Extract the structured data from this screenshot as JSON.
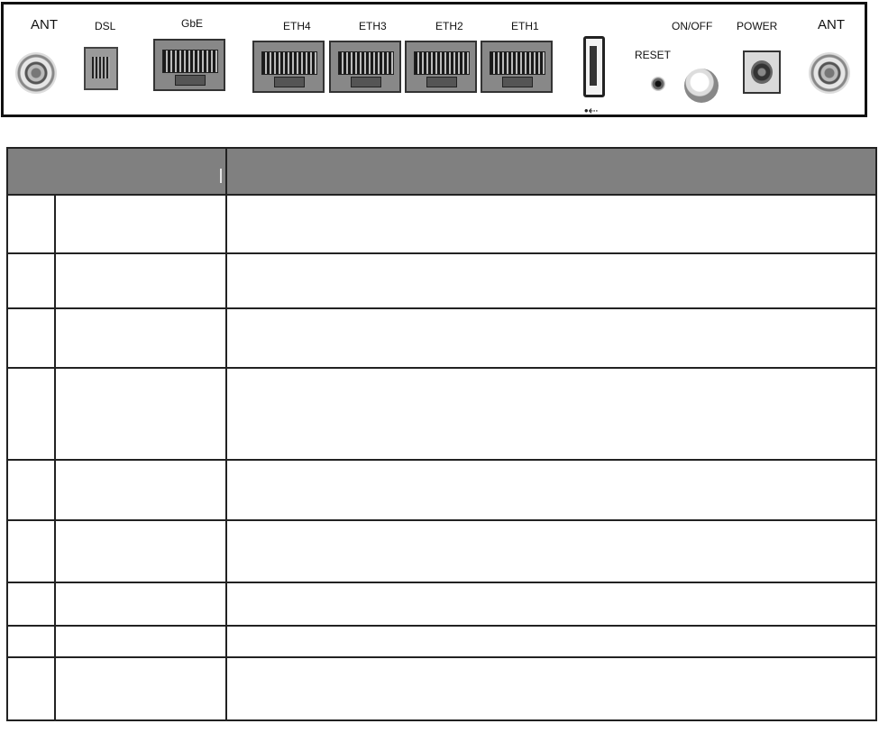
{
  "rear_panel": {
    "labels": {
      "ant_left": "ANT",
      "dsl": "DSL",
      "gbe": "GbE",
      "eth4": "ETH4",
      "eth3": "ETH3",
      "eth2": "ETH2",
      "eth1": "ETH1",
      "reset": "RESET",
      "onoff": "ON/OFF",
      "power": "POWER",
      "ant_right": "ANT",
      "usb_symbol": "•⇠"
    }
  },
  "table": {
    "header": {
      "left": "",
      "right": ""
    },
    "rows": [
      {
        "num": "",
        "name": "",
        "desc": ""
      },
      {
        "num": "",
        "name": "",
        "desc": ""
      },
      {
        "num": "",
        "name": "",
        "desc": ""
      },
      {
        "num": "",
        "name": "",
        "desc": ""
      },
      {
        "num": "",
        "name": "",
        "desc": ""
      },
      {
        "num": "",
        "name": "",
        "desc": ""
      },
      {
        "num": "",
        "name": "",
        "desc": ""
      },
      {
        "num": "",
        "name": "",
        "desc": ""
      },
      {
        "num": "",
        "name": "",
        "desc": ""
      }
    ]
  }
}
